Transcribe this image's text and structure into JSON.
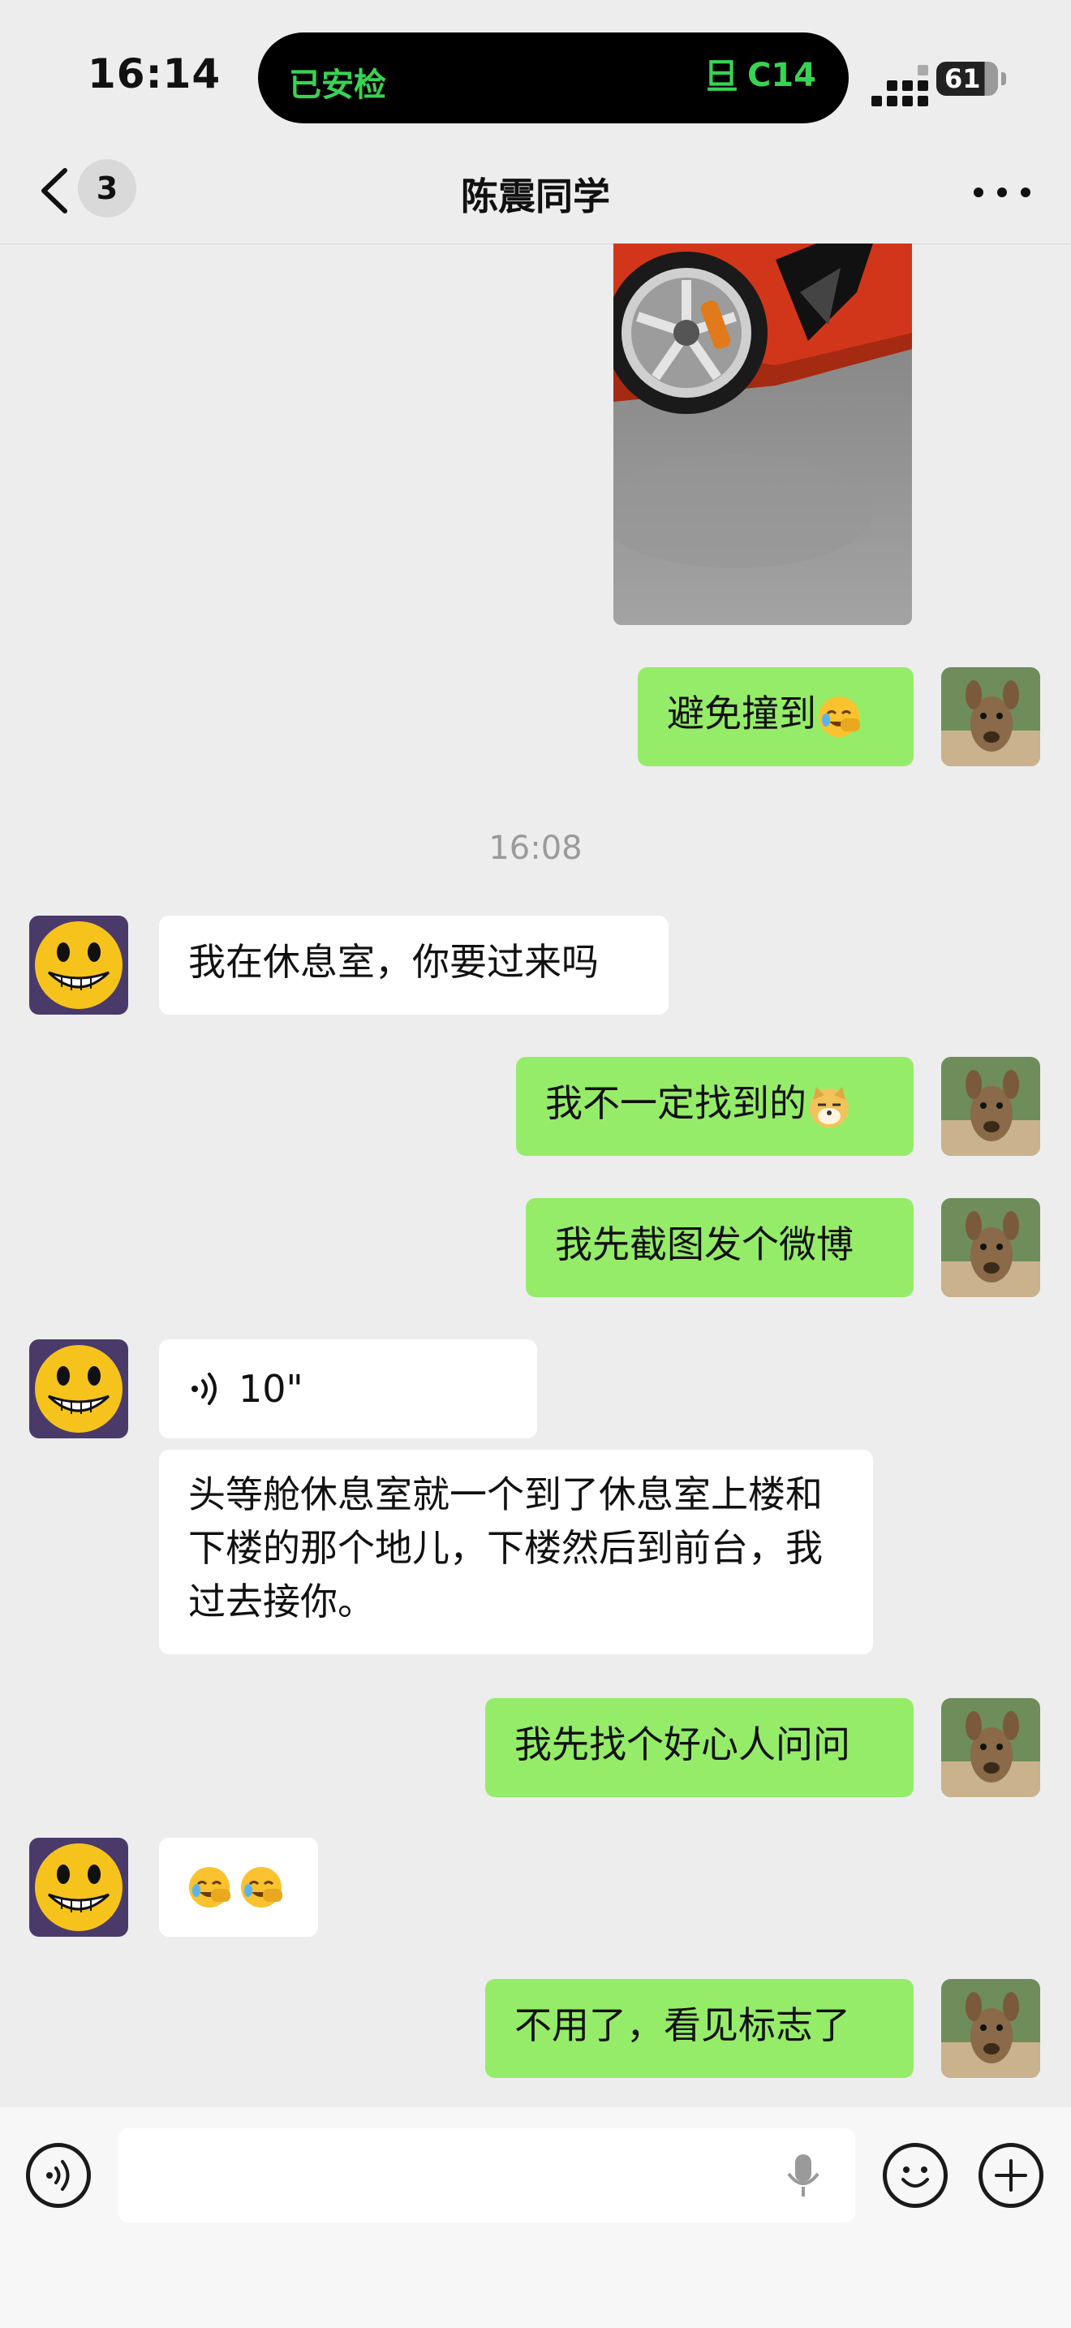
{
  "status_bar": {
    "time": "16:14",
    "island_left": "已安检",
    "island_right": "C14",
    "battery": "61"
  },
  "nav": {
    "unread_count": "3",
    "title": "陈震同学"
  },
  "timestamp": "16:08",
  "messages": [
    {
      "from": "me",
      "text": "避免撞到"
    },
    {
      "from": "them",
      "text": "我在休息室，你要过来吗"
    },
    {
      "from": "me",
      "text": "我不一定找到的"
    },
    {
      "from": "me",
      "text": "我先截图发个微博"
    },
    {
      "from": "them",
      "type": "voice",
      "duration": "10\""
    },
    {
      "from": "them",
      "text": "头等舱休息室就一个到了休息室上楼和下楼的那个地儿，下楼然后到前台，我过去接你。"
    },
    {
      "from": "me",
      "text": "我先找个好心人问问"
    },
    {
      "from": "them",
      "type": "emoji"
    },
    {
      "from": "me",
      "text": "不用了，看见标志了"
    }
  ],
  "colors": {
    "my_bubble": "#95ec69",
    "their_bubble": "#ffffff",
    "background": "#ededed",
    "island_text": "#39d353"
  }
}
